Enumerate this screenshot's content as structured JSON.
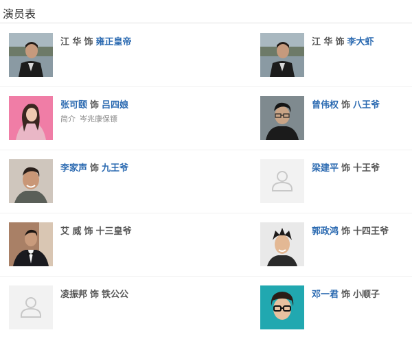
{
  "header": {
    "title": "演员表"
  },
  "separator_word": "饰",
  "rows": [
    {
      "left": {
        "actor": "江 华",
        "actor_link": false,
        "role": "雍正皇帝",
        "role_link": true,
        "photo": "actor-photo-man-dark-jacket"
      },
      "right": {
        "actor": "江 华",
        "actor_link": false,
        "role": "李大虾",
        "role_link": true,
        "photo": "actor-photo-man-dark-jacket"
      }
    },
    {
      "left": {
        "actor": "张可颐",
        "actor_link": true,
        "role": "吕四娘",
        "role_link": true,
        "photo": "actor-photo-woman-pink",
        "desc_key": "简介",
        "desc_value": "岑兆康保镖"
      },
      "right": {
        "actor": "曾伟权",
        "actor_link": true,
        "role": "八王爷",
        "role_link": true,
        "photo": "actor-photo-man-glasses"
      }
    },
    {
      "left": {
        "actor": "李家声",
        "actor_link": true,
        "role": "九王爷",
        "role_link": true,
        "photo": "actor-photo-man-smiling"
      },
      "right": {
        "actor": "梁建平",
        "actor_link": true,
        "role": "十王爷",
        "role_link": false,
        "photo": "placeholder-avatar"
      }
    },
    {
      "left": {
        "actor": "艾 威",
        "actor_link": false,
        "role": "十三皇爷",
        "role_link": false,
        "photo": "actor-photo-man-bowtie"
      },
      "right": {
        "actor": "郭政鸿",
        "actor_link": true,
        "role": "十四王爷",
        "role_link": false,
        "photo": "actor-photo-man-spiky-hair"
      }
    },
    {
      "left": {
        "actor": "凌振邦",
        "actor_link": false,
        "role": "铁公公",
        "role_link": false,
        "photo": "placeholder-avatar"
      },
      "right": {
        "actor": "邓一君",
        "actor_link": true,
        "role": "小顺子",
        "role_link": false,
        "photo": "actor-photo-man-black-glasses"
      }
    }
  ],
  "colors": {
    "link": "#2b6ab1",
    "text": "#555555",
    "border": "#e1e1e1"
  }
}
